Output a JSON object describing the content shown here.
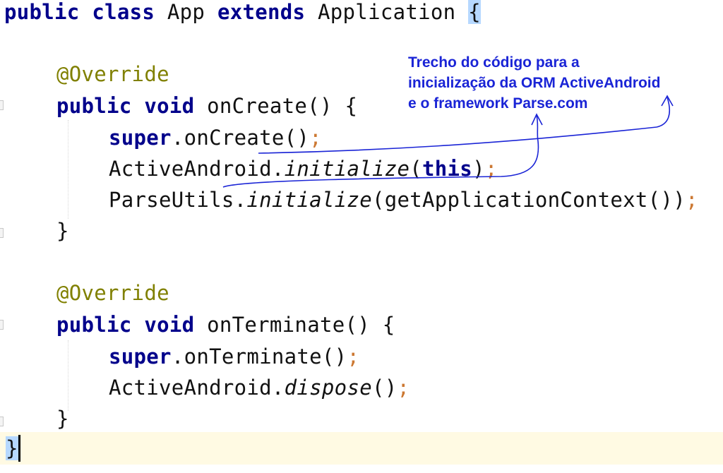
{
  "code": {
    "class_decl": {
      "kw1": "public class",
      "name": " App ",
      "kw2": "extends",
      "rest": " Application ",
      "open_brace": "{"
    },
    "on_create": {
      "annotation": "@Override",
      "signature": "public void",
      "method": " onCreate() {",
      "super_kw": "super",
      "super_call": ".onCreate()",
      "semi": ";",
      "aa_class": "ActiveAndroid.",
      "aa_method": "initialize",
      "aa_args_open": "(",
      "aa_this": "this",
      "aa_args_close": ")",
      "pu_class": "ParseUtils.",
      "pu_method": "initialize",
      "pu_args": "(getApplicationContext())",
      "close": "}"
    },
    "on_terminate": {
      "annotation": "@Override",
      "signature": "public void",
      "method": " onTerminate() {",
      "super_kw": "super",
      "super_call": ".onTerminate()",
      "semi": ";",
      "aa_class": "ActiveAndroid.",
      "aa_method": "dispose",
      "aa_args": "()",
      "close": "}"
    },
    "class_close": "}"
  },
  "note": {
    "line1": "Trecho do código para a",
    "line2": "inicialização da ORM ActiveAndroid",
    "line3": "e o framework Parse.com"
  },
  "colors": {
    "keyword": "#00008b",
    "annotation": "#808000",
    "semicolon": "#cc7832",
    "note": "#1a24d6",
    "current_line": "#fffae3"
  }
}
